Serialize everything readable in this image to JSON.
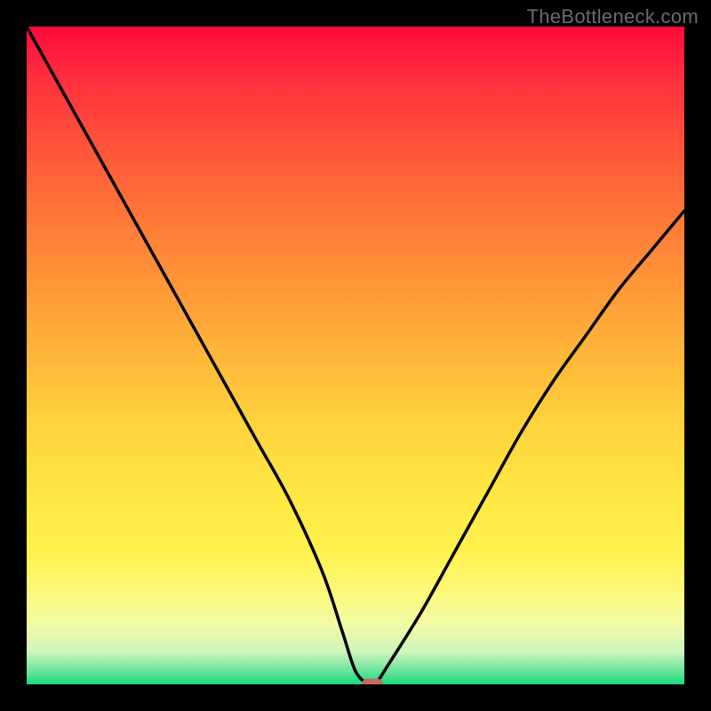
{
  "watermark": "TheBottleneck.com",
  "chart_data": {
    "type": "line",
    "title": "",
    "xlabel": "",
    "ylabel": "",
    "xlim": [
      0,
      100
    ],
    "ylim": [
      0,
      100
    ],
    "grid": false,
    "legend": false,
    "series": [
      {
        "name": "bottleneck-curve",
        "x": [
          0,
          5,
          10,
          15,
          20,
          25,
          30,
          35,
          40,
          45,
          48,
          50,
          52,
          53,
          55,
          60,
          65,
          70,
          75,
          80,
          85,
          90,
          95,
          100
        ],
        "values": [
          100,
          91,
          82,
          73,
          64,
          55,
          46,
          37,
          28,
          17,
          8,
          2,
          0,
          0,
          3,
          11,
          20,
          29,
          38,
          46,
          53,
          60,
          66,
          72
        ]
      }
    ],
    "marker": {
      "x": 52.5,
      "y": 0
    },
    "background_gradient": {
      "stops": [
        {
          "pos": 0.0,
          "color": "#ff0a3c"
        },
        {
          "pos": 0.08,
          "color": "#ff2f3d"
        },
        {
          "pos": 0.2,
          "color": "#ff5a3a"
        },
        {
          "pos": 0.33,
          "color": "#ff8438"
        },
        {
          "pos": 0.47,
          "color": "#ffae39"
        },
        {
          "pos": 0.6,
          "color": "#ffd23c"
        },
        {
          "pos": 0.7,
          "color": "#ffe541"
        },
        {
          "pos": 0.8,
          "color": "#fff24d"
        },
        {
          "pos": 0.86,
          "color": "#fcf97b"
        },
        {
          "pos": 0.91,
          "color": "#f1faa6"
        },
        {
          "pos": 0.95,
          "color": "#cff6bd"
        },
        {
          "pos": 0.98,
          "color": "#69e49a"
        },
        {
          "pos": 1.0,
          "color": "#17d981"
        }
      ]
    }
  }
}
